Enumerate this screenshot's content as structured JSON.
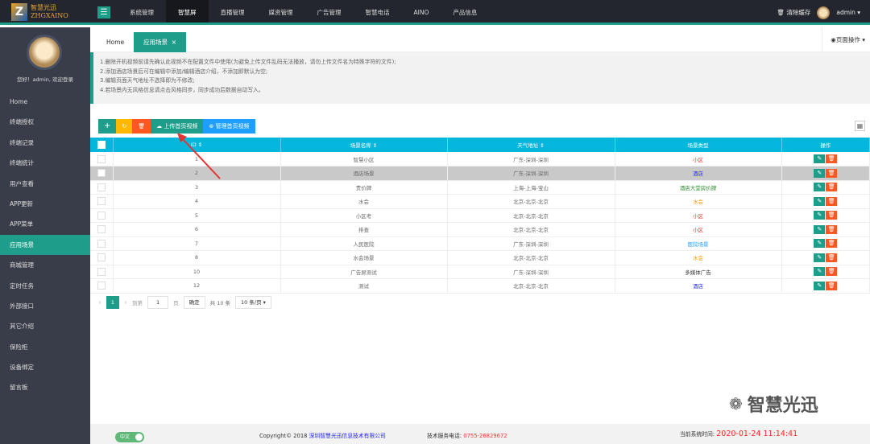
{
  "header": {
    "logo_cn": "智慧光迅",
    "logo_en": "ZHGXAINO",
    "nav": [
      "系统管理",
      "智慧屏",
      "直播管理",
      "媒资管理",
      "广告管理",
      "智慧电话",
      "AINO",
      "产品信息"
    ],
    "active_nav": 1,
    "clear_cache": "清除缓存",
    "user": "admin"
  },
  "sidebar": {
    "welcome": "您好！admin, 欢迎登录",
    "items": [
      "Home",
      "终端授权",
      "终端记录",
      "终端统计",
      "用户查看",
      "APP更新",
      "APP菜单",
      "应用场景",
      "商城管理",
      "定时任务",
      "外部接口",
      "其它介绍",
      "保险柜",
      "设备绑定",
      "留言板"
    ],
    "active": 7
  },
  "tabs": {
    "home": "Home",
    "current": "应用场景",
    "close": "×",
    "page_ops": "页面操作"
  },
  "notice": [
    "1.删除开机视频前请先确认此视频不在配置文件中使用(为避免上传文件乱码无法播放，请勿上传文件名为特殊字符的文件);",
    "2.添加酒店场景后可在编辑中添加/编辑酒店介绍，不添加即默认为空;",
    "3.编辑页面天气地址不选择即为不修改;",
    "4.若场景内无风格信息请点击风格同步，同步成功后数据自动写入。"
  ],
  "toolbar": {
    "add": "+",
    "refresh": "↻",
    "delete": "🗑",
    "upload": "上传首页视频",
    "manage": "管理首页视频"
  },
  "colors": {
    "accent": "#1e9e8a",
    "header_bg": "#23262e",
    "sidebar_bg": "#393d49",
    "table_header": "#05b7dd",
    "danger": "#ff5722",
    "warn": "#ffb800"
  },
  "table": {
    "columns": [
      "ID",
      "场景名称",
      "天气地址",
      "场景类型",
      "操作"
    ],
    "rows": [
      {
        "id": "1",
        "name": "智慧小区",
        "addr": "广东-深圳-深圳",
        "type": "小区",
        "type_color": "#ff3333"
      },
      {
        "id": "2",
        "name": "酒店场景",
        "addr": "广东-深圳-深圳",
        "type": "酒店",
        "type_color": "#2222ff",
        "selected": true
      },
      {
        "id": "3",
        "name": "责价牌",
        "addr": "上海-上海-宝山",
        "type": "酒店大堂房价牌",
        "type_color": "#228b22"
      },
      {
        "id": "4",
        "name": "水会",
        "addr": "北京-北京-北京",
        "type": "水会",
        "type_color": "#ff9900"
      },
      {
        "id": "5",
        "name": "小区考",
        "addr": "北京-北京-北京",
        "type": "小区",
        "type_color": "#ff3333"
      },
      {
        "id": "6",
        "name": "排查",
        "addr": "北京-北京-北京",
        "type": "小区",
        "type_color": "#ff3333"
      },
      {
        "id": "7",
        "name": "人民医院",
        "addr": "广东-深圳-深圳",
        "type": "医院场景",
        "type_color": "#1e9fff"
      },
      {
        "id": "8",
        "name": "水会场景",
        "addr": "北京-北京-北京",
        "type": "水会",
        "type_color": "#ff9900"
      },
      {
        "id": "10",
        "name": "广告屏测试",
        "addr": "广东-深圳-深圳",
        "type": "多媒体广告",
        "type_color": "#333333"
      },
      {
        "id": "12",
        "name": "测试",
        "addr": "北京-北京-北京",
        "type": "酒店",
        "type_color": "#2222ff"
      }
    ]
  },
  "pager": {
    "prev": "‹",
    "page": "1",
    "next": "›",
    "goto": "到第",
    "input": "1",
    "unit": "页",
    "confirm": "确定",
    "total": "共 10 条",
    "per_page": "10 条/页"
  },
  "footer": {
    "lang": "中文",
    "copyright": "Copyright© 2018",
    "company": "深圳智慧光迅信息技术有限公司",
    "phone_label": "技术服务电话:",
    "phone": "0755-26829672",
    "time_label": "当前系统时间:",
    "time": "2020-01-24 11:14:41"
  },
  "watermark": "智慧光迅"
}
